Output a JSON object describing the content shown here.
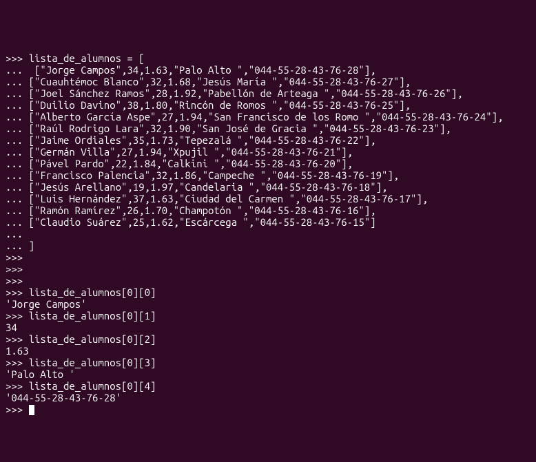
{
  "terminal": {
    "lines": [
      ">>> lista_de_alumnos = [",
      "...  [\"Jorge Campos\",34,1.63,\"Palo Alto \",\"044-55-28-43-76-28\"],",
      "... [\"Cuauhtémoc Blanco\",32,1.68,\"Jesús María \",\"044-55-28-43-76-27\"],",
      "... [\"Joel Sánchez Ramos\",28,1.92,\"Pabellón de Arteaga \",\"044-55-28-43-76-26\"],",
      "... [\"Duilio Davino\",38,1.80,\"Rincón de Romos \",\"044-55-28-43-76-25\"],",
      "... [\"Alberto García Aspe\",27,1.94,\"San Francisco de los Romo \",\"044-55-28-43-76-24\"],",
      "... [\"Raúl Rodrigo Lara\",32,1.90,\"San José de Gracia \",\"044-55-28-43-76-23\"],",
      "... [\"Jaime Ordiales\",35,1.73,\"Tepezalá \",\"044-55-28-43-76-22\"],",
      "... [\"Germán Villa\",27,1.94,\"Xpujil \",\"044-55-28-43-76-21\"],",
      "... [\"Pável Pardo\",22,1.84,\"Calkini \",\"044-55-28-43-76-20\"],",
      "... [\"Francisco Palencia\",32,1.86,\"Campeche \",\"044-55-28-43-76-19\"],",
      "... [\"Jesús Arellano\",19,1.97,\"Candelaria \",\"044-55-28-43-76-18\"],",
      "... [\"Luis Hernández\",37,1.63,\"Ciudad del Carmen \",\"044-55-28-43-76-17\"],",
      "... [\"Ramón Ramírez\",26,1.70,\"Champotón \",\"044-55-28-43-76-16\"],",
      "... [\"Claudio Suárez\",25,1.62,\"Escárcega \",\"044-55-28-43-76-15\"]",
      "... ",
      "... ]",
      ">>> ",
      ">>> ",
      ">>> ",
      ">>> lista_de_alumnos[0][0]",
      "'Jorge Campos'",
      ">>> lista_de_alumnos[0][1]",
      "34",
      ">>> lista_de_alumnos[0][2]",
      "1.63",
      ">>> lista_de_alumnos[0][3]",
      "'Palo Alto '",
      ">>> lista_de_alumnos[0][4]",
      "'044-55-28-43-76-28'"
    ],
    "current_prompt": ">>> "
  }
}
